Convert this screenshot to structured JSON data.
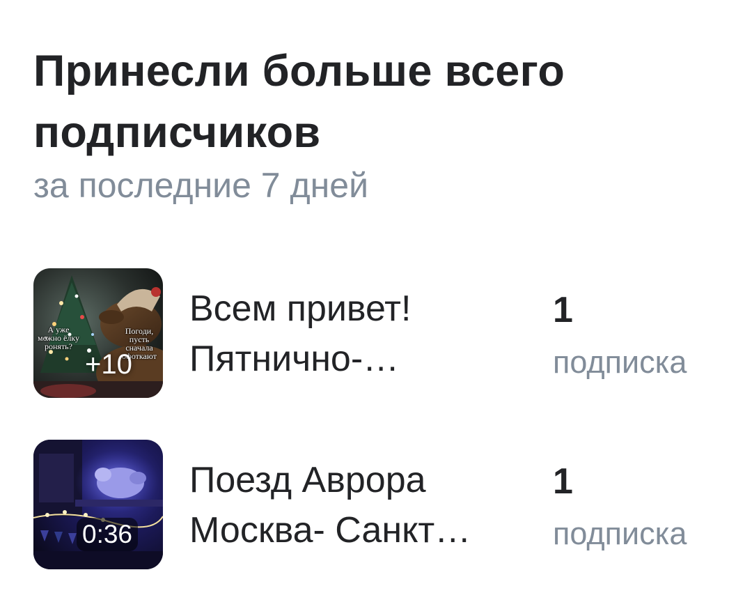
{
  "header": {
    "title": "Принесли больше всего подписчиков",
    "subtitle": "за последние 7 дней"
  },
  "posts": [
    {
      "text_line1": "Всем привет!",
      "text_line2": "Пятнично-…",
      "thumb_badge": "+10",
      "meme_left": "А уже можно ёлку ронять?",
      "meme_right": "Погоди, пусть сначала офоткают",
      "count": "1",
      "count_label": "подписка"
    },
    {
      "text_line1": "Поезд Аврора",
      "text_line2": "Москва- Санкт…",
      "thumb_duration": "0:36",
      "count": "1",
      "count_label": "подписка"
    }
  ],
  "colors": {
    "primary_text": "#222326",
    "secondary_text": "#818c99",
    "background": "#ffffff"
  }
}
